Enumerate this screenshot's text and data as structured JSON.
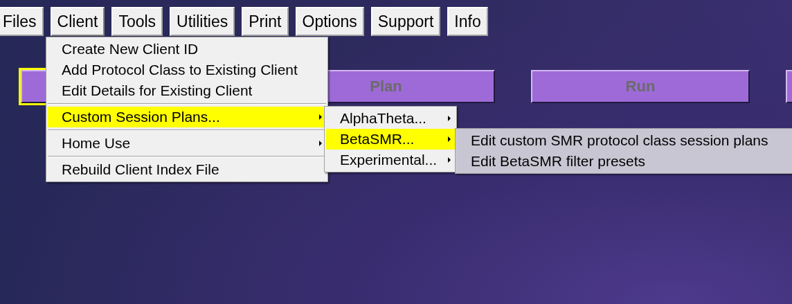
{
  "menu_bar": [
    {
      "label": "Files",
      "selected": false
    },
    {
      "label": "Client",
      "selected": true
    },
    {
      "label": "Tools",
      "selected": false
    },
    {
      "label": "Utilities",
      "selected": false
    },
    {
      "label": "Print",
      "selected": false
    },
    {
      "label": "Options",
      "selected": false
    },
    {
      "label": "Support",
      "selected": false
    },
    {
      "label": "Info",
      "selected": false
    }
  ],
  "main_buttons": [
    {
      "focused": true,
      "disabled": true
    },
    {
      "label": "Plan",
      "focused": false,
      "disabled": true
    },
    {
      "label": "Run",
      "focused": false,
      "disabled": true
    },
    {
      "focused": false
    }
  ],
  "client_menu": [
    {
      "kind": "item",
      "label": "Create New Client ID",
      "submenu": false,
      "selected": false
    },
    {
      "kind": "item",
      "label": "Add Protocol Class to Existing Client",
      "submenu": false,
      "selected": false
    },
    {
      "kind": "item",
      "label": "Edit Details for Existing Client",
      "submenu": false,
      "selected": false
    },
    {
      "kind": "separator"
    },
    {
      "kind": "item",
      "label": "Custom Session Plans...",
      "submenu": true,
      "selected": true
    },
    {
      "kind": "separator"
    },
    {
      "kind": "item",
      "label": "Home Use",
      "submenu": true,
      "selected": false
    },
    {
      "kind": "separator"
    },
    {
      "kind": "item",
      "label": "Rebuild Client Index File",
      "submenu": false,
      "selected": false
    }
  ],
  "session_plans_menu": [
    {
      "kind": "item",
      "label": "AlphaTheta...",
      "submenu": true,
      "selected": false
    },
    {
      "kind": "item",
      "label": "BetaSMR...",
      "submenu": true,
      "selected": true
    },
    {
      "kind": "item",
      "label": "Experimental...",
      "submenu": true,
      "selected": false
    }
  ],
  "betasmr_menu": [
    {
      "kind": "item",
      "label": "Edit custom SMR protocol class session plans",
      "selected": false
    },
    {
      "kind": "item",
      "label": "Edit BetaSMR filter presets",
      "selected": false
    }
  ]
}
